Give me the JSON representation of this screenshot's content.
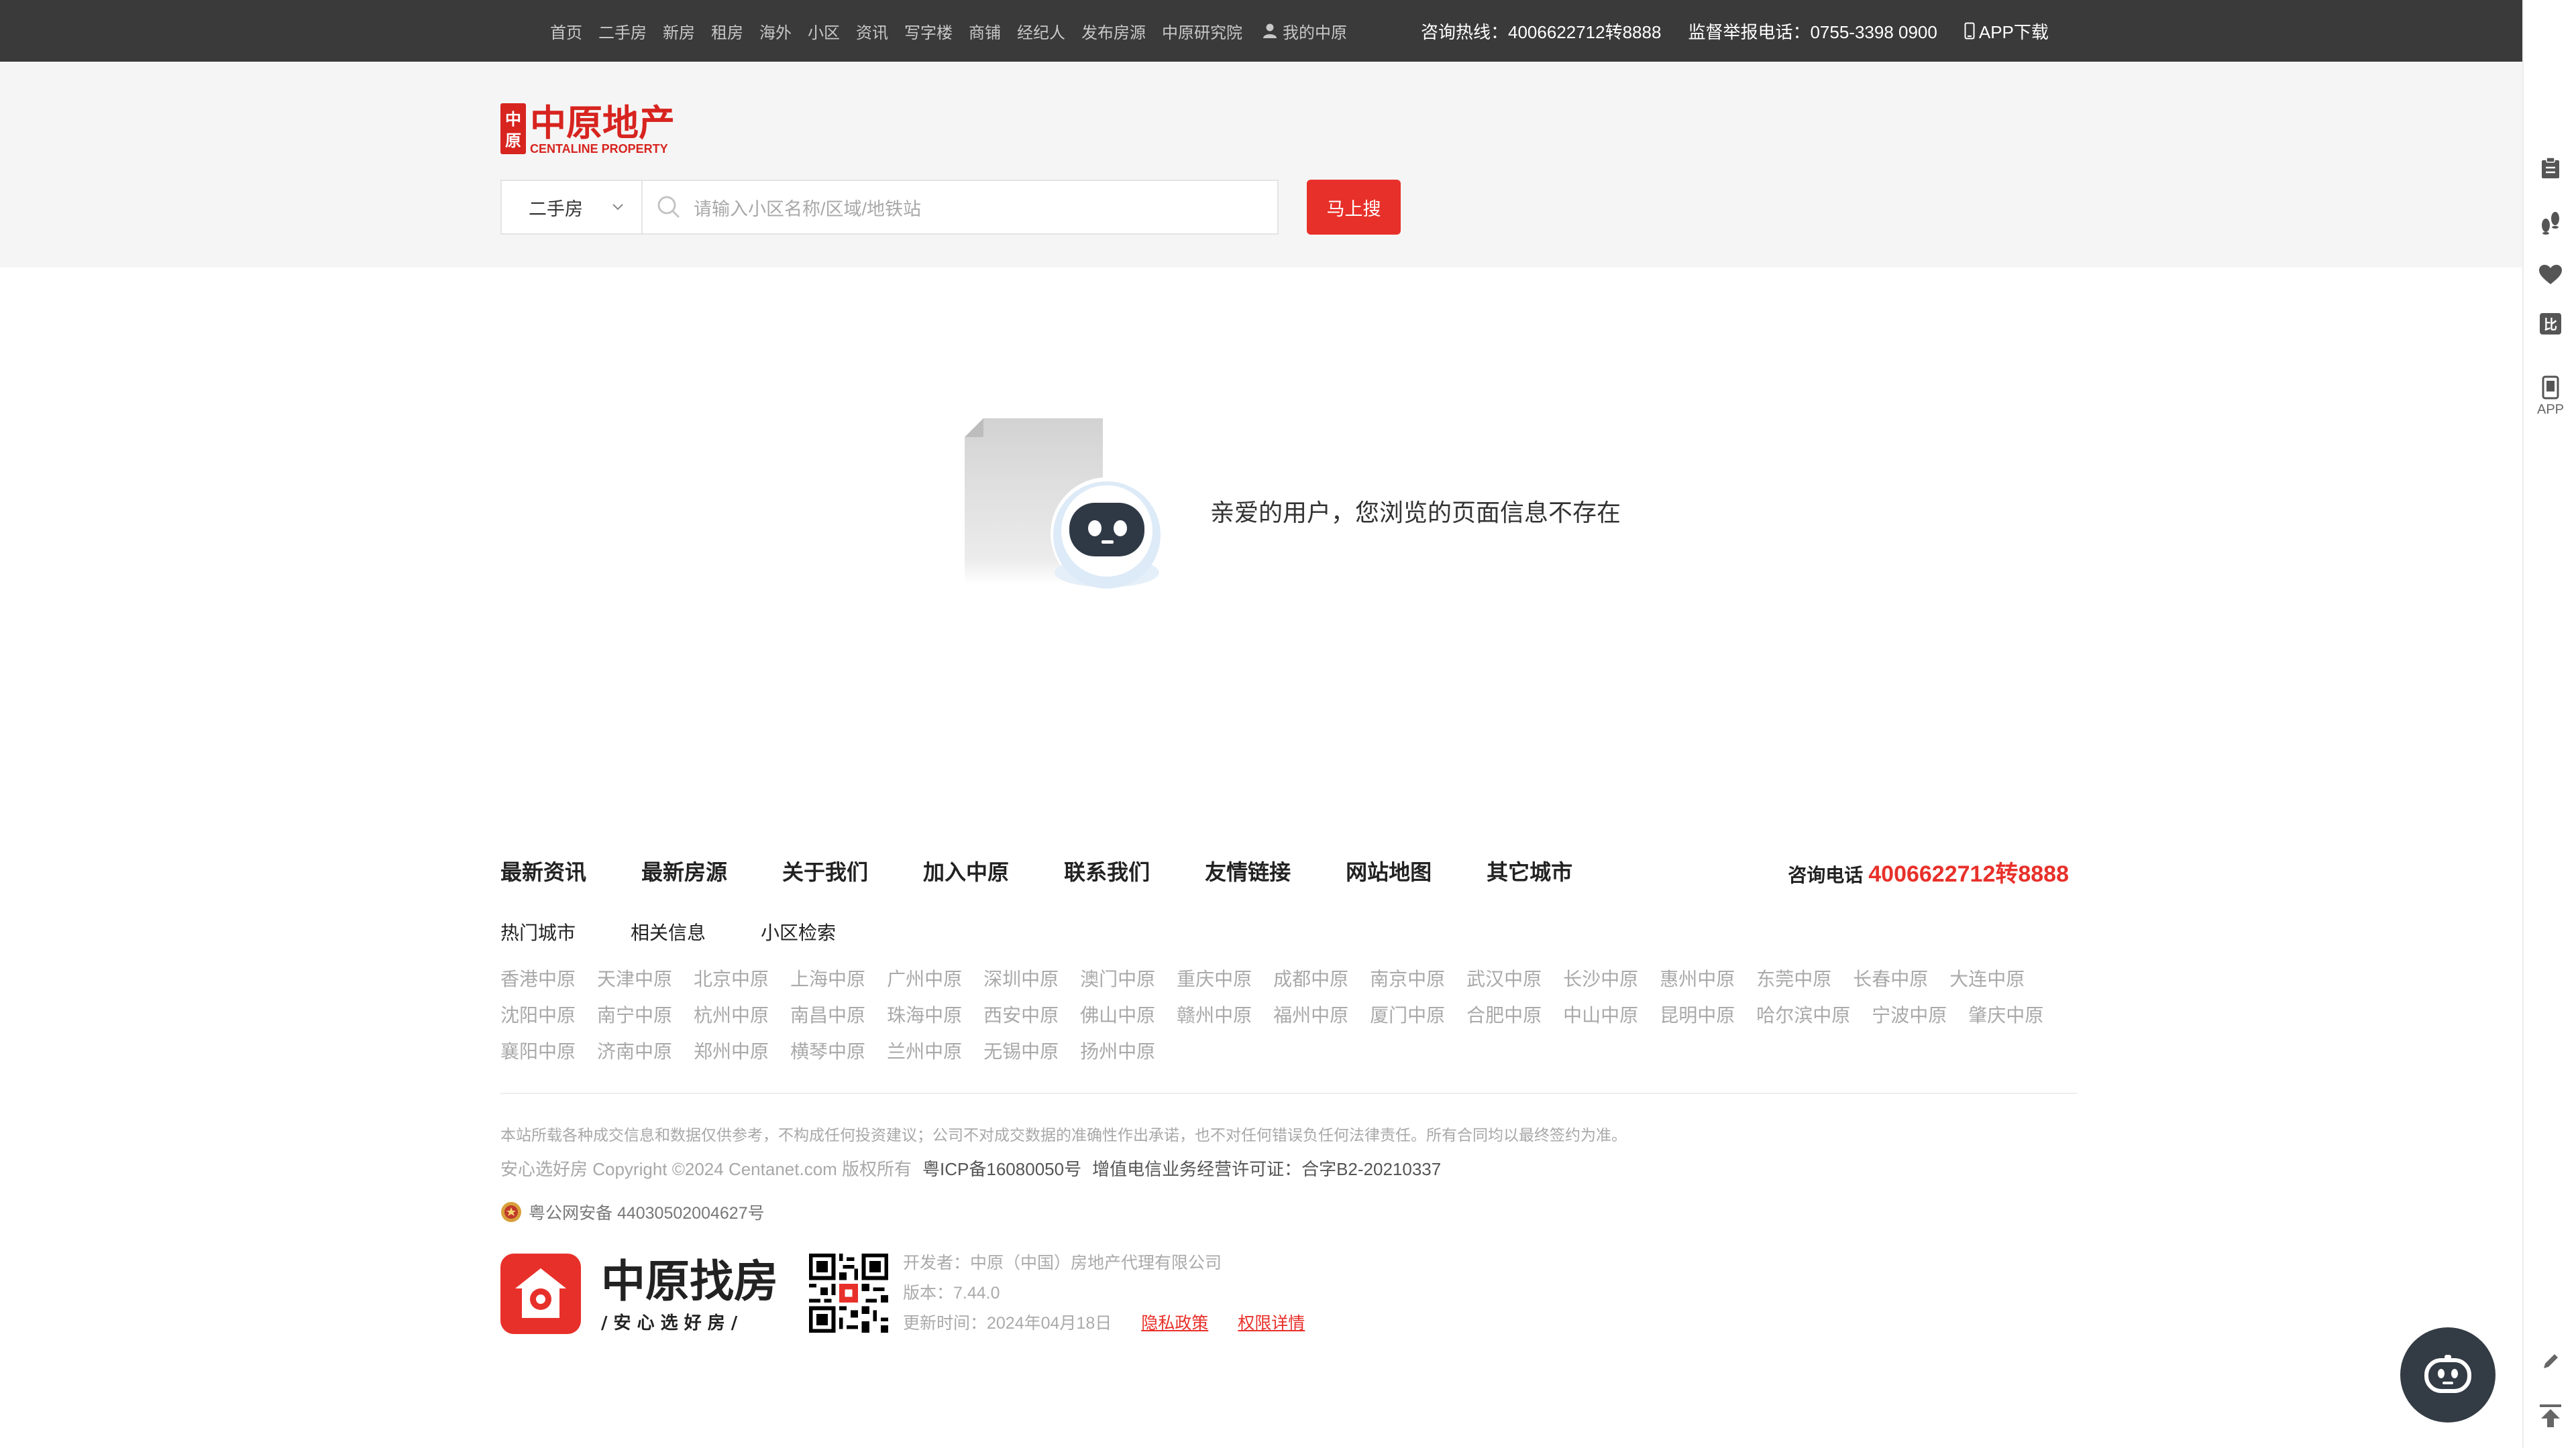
{
  "topbar": {
    "nav": [
      "首页",
      "二手房",
      "新房",
      "租房",
      "海外",
      "小区",
      "资讯",
      "写字楼",
      "商铺",
      "经纪人",
      "发布房源",
      "中原研究院"
    ],
    "my_center": "我的中原",
    "hotline": "咨询热线：4006622712转8888",
    "report_line": "监督举报电话：0755-3398 0900",
    "app_download": "APP下载"
  },
  "header": {
    "logo_cn": "中原地产",
    "logo_en": "CENTALINE PROPERTY",
    "search": {
      "type_selected": "二手房",
      "placeholder": "请输入小区名称/区域/地铁站",
      "button": "马上搜"
    }
  },
  "sidebar": {
    "app_label": "APP"
  },
  "empty": {
    "message": "亲爱的用户，您浏览的页面信息不存在"
  },
  "footer": {
    "nav": [
      "最新资讯",
      "最新房源",
      "关于我们",
      "加入中原",
      "联系我们",
      "友情链接",
      "网站地图",
      "其它城市"
    ],
    "phone_label": "咨询电话",
    "phone_number": "4006622712转8888",
    "tabs": [
      "热门城市",
      "相关信息",
      "小区检索"
    ],
    "cities": [
      "香港中原",
      "天津中原",
      "北京中原",
      "上海中原",
      "广州中原",
      "深圳中原",
      "澳门中原",
      "重庆中原",
      "成都中原",
      "南京中原",
      "武汉中原",
      "长沙中原",
      "惠州中原",
      "东莞中原",
      "长春中原",
      "大连中原",
      "沈阳中原",
      "南宁中原",
      "杭州中原",
      "南昌中原",
      "珠海中原",
      "西安中原",
      "佛山中原",
      "赣州中原",
      "福州中原",
      "厦门中原",
      "合肥中原",
      "中山中原",
      "昆明中原",
      "哈尔滨中原",
      "宁波中原",
      "肇庆中原",
      "襄阳中原",
      "济南中原",
      "郑州中原",
      "横琴中原",
      "兰州中原",
      "无锡中原",
      "扬州中原"
    ],
    "disclaimer": "本站所载各种成交信息和数据仅供参考，不构成任何投资建议；公司不对成交数据的准确性作出承诺，也不对任何错误负任何法律责任。所有合同均以最终签约为准。",
    "copyright": "安心选好房 Copyright ©2024 Centanet.com 版权所有",
    "icp": "粤ICP备16080050号",
    "license": "增值电信业务经营许可证：合字B2-20210337",
    "police": "粤公网安备 44030502004627号",
    "app_name": "中原找房",
    "app_slogan": "/ 安 心 选 好 房 /",
    "developer": "开发者：中原（中国）房地产代理有限公司",
    "version": "版本：7.44.0",
    "updated": "更新时间：2024年04月18日",
    "privacy": "隐私政策",
    "permissions": "权限详情"
  }
}
